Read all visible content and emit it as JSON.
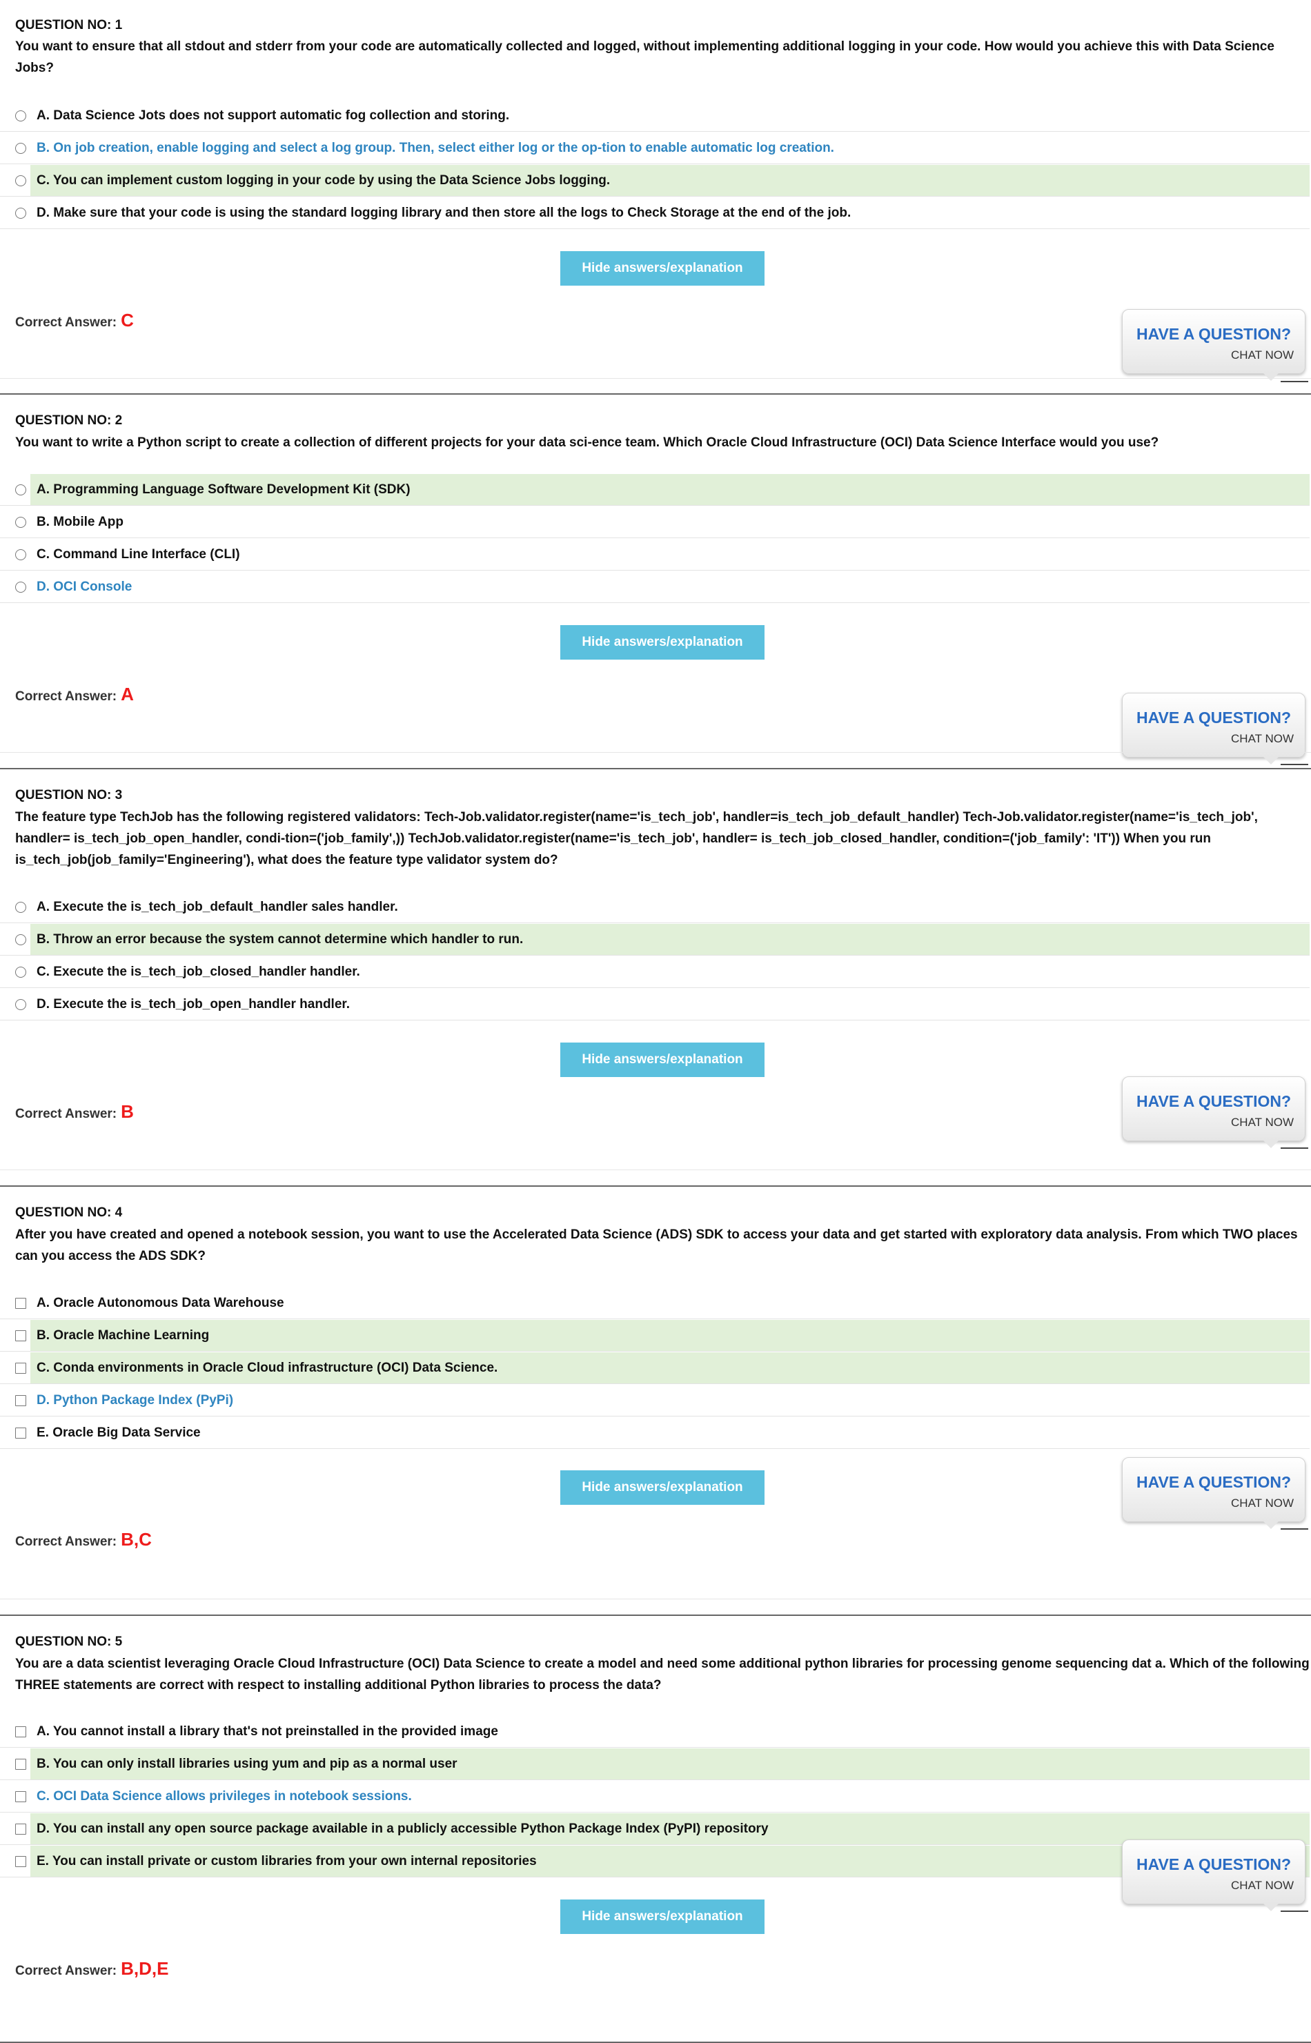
{
  "questions": [
    {
      "number_label": "QUESTION NO: 1",
      "text": "You want to ensure that all stdout and stderr from your code are automatically collected and logged, without implementing additional logging in your code. How would you achieve this with Data Science Jobs?",
      "input_type": "radio",
      "options": [
        {
          "label": "A. Data Science Jots does not support automatic fog collection and storing.",
          "highlighted": false,
          "blue": false
        },
        {
          "label": "B. On job creation, enable logging and select a log group. Then, select either log or the op-tion to enable automatic log creation.",
          "highlighted": false,
          "blue": true
        },
        {
          "label": "C. You can implement custom logging in your code by using the Data Science Jobs logging.",
          "highlighted": true,
          "blue": false
        },
        {
          "label": "D. Make sure that your code is using the standard logging library and then store all the logs to Check Storage at the end of the job.",
          "highlighted": false,
          "blue": false
        }
      ],
      "button_label": "Hide answers/explanation",
      "correct_label": "Correct Answer:",
      "correct_answer": "C"
    },
    {
      "number_label": "QUESTION NO: 2",
      "text": "You want to write a Python script to create a collection of different projects for your data sci-ence team. Which Oracle Cloud Infrastructure (OCI) Data Science Interface would you use?",
      "input_type": "radio",
      "options": [
        {
          "label": "A. Programming Language Software Development Kit (SDK)",
          "highlighted": true,
          "blue": false
        },
        {
          "label": "B. Mobile App",
          "highlighted": false,
          "blue": false
        },
        {
          "label": "C. Command Line Interface (CLI)",
          "highlighted": false,
          "blue": false
        },
        {
          "label": "D. OCI Console",
          "highlighted": false,
          "blue": true
        }
      ],
      "button_label": "Hide answers/explanation",
      "correct_label": "Correct Answer:",
      "correct_answer": "A"
    },
    {
      "number_label": "QUESTION NO: 3",
      "text": "The feature type TechJob has the following registered validators: Tech-Job.validator.register(name='is_tech_job', handler=is_tech_job_default_handler) Tech-Job.validator.register(name='is_tech_job', handler= is_tech_job_open_handler, condi-tion=('job_family',)) TechJob.validator.register(name='is_tech_job', handler= is_tech_job_closed_handler, condition=('job_family': 'IT')) When you run is_tech_job(job_family='Engineering'), what does the feature type validator system do?",
      "input_type": "radio",
      "options": [
        {
          "label": "A. Execute the is_tech_job_default_handler sales handler.",
          "highlighted": false,
          "blue": false
        },
        {
          "label": "B. Throw an error because the system cannot determine which handler to run.",
          "highlighted": true,
          "blue": false
        },
        {
          "label": "C. Execute the is_tech_job_closed_handler handler.",
          "highlighted": false,
          "blue": false
        },
        {
          "label": "D. Execute the is_tech_job_open_handler handler.",
          "highlighted": false,
          "blue": false
        }
      ],
      "button_label": "Hide answers/explanation",
      "correct_label": "Correct Answer:",
      "correct_answer": "B"
    },
    {
      "number_label": "QUESTION NO: 4",
      "text": "After you have created and opened a notebook session, you want to use the Accelerated Data Science (ADS) SDK to access your data and get started with exploratory data analysis. From which TWO places can you access the ADS SDK?",
      "input_type": "checkbox",
      "options": [
        {
          "label": "A. Oracle Autonomous Data Warehouse",
          "highlighted": false,
          "blue": false
        },
        {
          "label": "B. Oracle Machine Learning",
          "highlighted": true,
          "blue": false
        },
        {
          "label": "C. Conda environments in Oracle Cloud infrastructure (OCI) Data Science.",
          "highlighted": true,
          "blue": false
        },
        {
          "label": "D. Python Package Index (PyPi)",
          "highlighted": false,
          "blue": true
        },
        {
          "label": "E. Oracle Big Data Service",
          "highlighted": false,
          "blue": false
        }
      ],
      "button_label": "Hide answers/explanation",
      "correct_label": "Correct Answer:",
      "correct_answer": "B,C"
    },
    {
      "number_label": "QUESTION NO: 5",
      "text": "You are a data scientist leveraging Oracle Cloud Infrastructure (OCI) Data Science to create a model and need some additional python libraries for processing genome sequencing dat a. Which of the following THREE statements are correct with respect to installing additional Python libraries to process the data?",
      "input_type": "checkbox",
      "options": [
        {
          "label": "A. You cannot install a library that's not preinstalled in the provided image",
          "highlighted": false,
          "blue": false
        },
        {
          "label": "B. You can only install libraries using yum and pip as a normal user",
          "highlighted": true,
          "blue": false
        },
        {
          "label": "C. OCI Data Science allows privileges in notebook sessions.",
          "highlighted": false,
          "blue": true
        },
        {
          "label": "D. You can install any open source package available in a publicly accessible Python Package Index (PyPI) repository",
          "highlighted": true,
          "blue": false
        },
        {
          "label": "E. You can install private or custom libraries from your own internal repositories",
          "highlighted": true,
          "blue": false
        }
      ],
      "button_label": "Hide answers/explanation",
      "correct_label": "Correct Answer:",
      "correct_answer": "B,D,E"
    }
  ],
  "chat_widget": {
    "title": "HAVE A QUESTION?",
    "subtitle": "CHAT NOW"
  },
  "colors": {
    "highlight_bg": "#e1f0d8",
    "option_blue": "#2f85c0",
    "button_bg": "#5bc0de",
    "answer_red": "#ee1c1c",
    "chat_title": "#2a6cc3"
  }
}
